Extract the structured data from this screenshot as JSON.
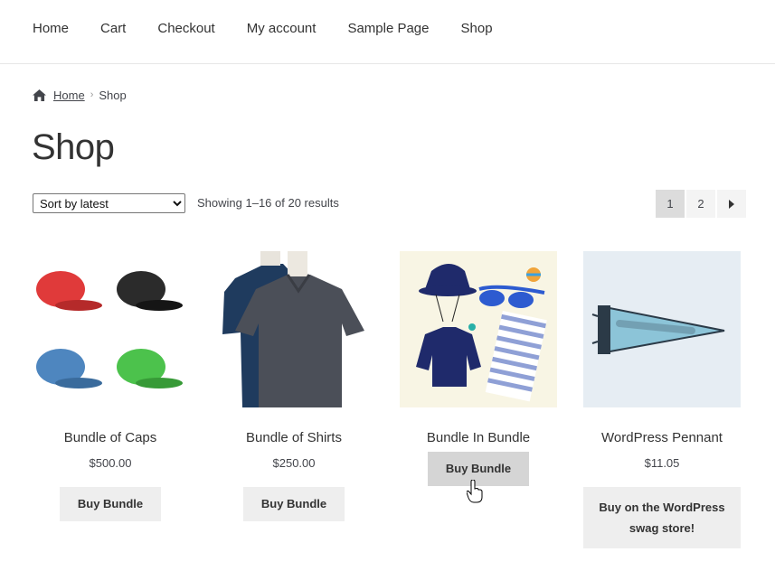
{
  "nav": {
    "items": [
      "Home",
      "Cart",
      "Checkout",
      "My account",
      "Sample Page",
      "Shop"
    ]
  },
  "breadcrumb": {
    "home": "Home",
    "separator": "›",
    "current": "Shop"
  },
  "page": {
    "title": "Shop"
  },
  "toolbar": {
    "sort_selected": "Sort by latest",
    "result_count": "Showing 1–16 of 20 results"
  },
  "pagination": {
    "pages": [
      "1",
      "2"
    ],
    "current": "1"
  },
  "products": [
    {
      "name": "Bundle of Caps",
      "price": "$500.00",
      "button": "Buy Bundle",
      "image": "caps-image"
    },
    {
      "name": "Bundle of Shirts",
      "price": "$250.00",
      "button": "Buy Bundle",
      "image": "shirts-image"
    },
    {
      "name": "Bundle In Bundle",
      "price": "",
      "button": "Buy Bundle",
      "image": "beach-bundle-image"
    },
    {
      "name": "WordPress Pennant",
      "price": "$11.05",
      "button": "Buy on the WordPress swag store!",
      "image": "pennant-image"
    }
  ],
  "colors": {
    "button_bg": "#eeeeee",
    "button_hover_bg": "#d5d5d5",
    "text": "#43454b",
    "heading": "#333333",
    "pagination_current": "#dcdcdc"
  }
}
